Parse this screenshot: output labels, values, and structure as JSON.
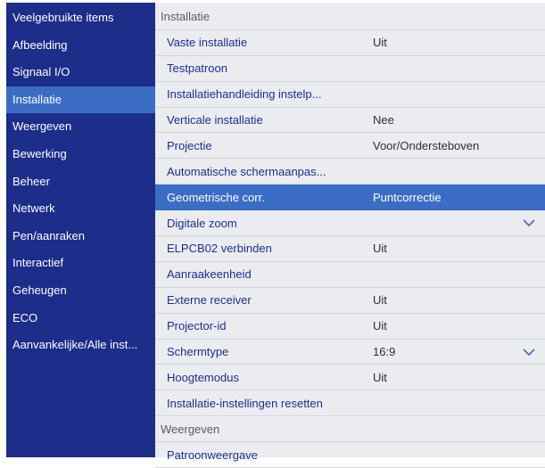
{
  "sidebar": {
    "items": [
      {
        "label": "Veelgebruikte items",
        "active": false
      },
      {
        "label": "Afbeelding",
        "active": false
      },
      {
        "label": "Signaal I/O",
        "active": false
      },
      {
        "label": "Installatie",
        "active": true
      },
      {
        "label": "Weergeven",
        "active": false
      },
      {
        "label": "Bewerking",
        "active": false
      },
      {
        "label": "Beheer",
        "active": false
      },
      {
        "label": "Netwerk",
        "active": false
      },
      {
        "label": "Pen/aanraken",
        "active": false
      },
      {
        "label": "Interactief",
        "active": false
      },
      {
        "label": "Geheugen",
        "active": false
      },
      {
        "label": "ECO",
        "active": false
      },
      {
        "label": "Aanvankelijke/Alle inst...",
        "active": false
      }
    ]
  },
  "main": {
    "section_installatie": "Installatie",
    "items": [
      {
        "label": "Vaste installatie",
        "value": "Uit"
      },
      {
        "label": "Testpatroon",
        "value": ""
      },
      {
        "label": "Installatiehandleiding instelp...",
        "value": ""
      },
      {
        "label": "Verticale installatie",
        "value": "Nee"
      },
      {
        "label": "Projectie",
        "value": "Voor/Ondersteboven"
      },
      {
        "label": "Automatische schermaanpas...",
        "value": ""
      },
      {
        "label": "Geometrische corr.",
        "value": "Puntcorrectie",
        "selected": true
      },
      {
        "label": "Digitale zoom",
        "value": "",
        "chevron": "chevron-down-icon"
      },
      {
        "label": "ELPCB02 verbinden",
        "value": "Uit"
      },
      {
        "label": "Aanraakeenheid",
        "value": ""
      },
      {
        "label": "Externe receiver",
        "value": "Uit"
      },
      {
        "label": "Projector-id",
        "value": "Uit"
      },
      {
        "label": "Schermtype",
        "value": "16:9",
        "chevron": "chevron-down-icon"
      },
      {
        "label": "Hoogtemodus",
        "value": "Uit"
      },
      {
        "label": "Installatie-instellingen resetten",
        "value": ""
      }
    ],
    "section_weergeven": "Weergeven",
    "weergeven_items": [
      {
        "label": "Patroonweergave",
        "value": ""
      }
    ]
  },
  "colors": {
    "sidebar_bg": "#1c2d8a",
    "selection": "#3b6dc4",
    "panel_bg": "#ebecf0",
    "item_text": "#1d2e8a"
  }
}
